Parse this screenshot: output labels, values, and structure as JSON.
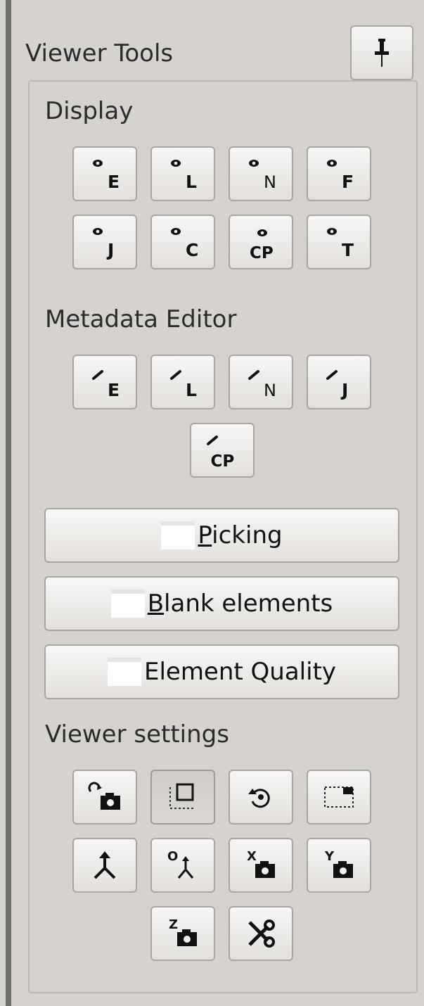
{
  "panel": {
    "title": "Viewer Tools",
    "pin_icon": "pin-icon"
  },
  "display": {
    "label": "Display",
    "buttons": [
      {
        "letter": "E",
        "icon": "eye-icon"
      },
      {
        "letter": "L",
        "icon": "eye-icon"
      },
      {
        "letter": "N",
        "icon": "eye-icon"
      },
      {
        "letter": "F",
        "icon": "eye-icon"
      },
      {
        "letter": "J",
        "icon": "eye-icon"
      },
      {
        "letter": "C",
        "icon": "eye-icon"
      },
      {
        "letter": "CP",
        "icon": "eye-icon"
      },
      {
        "letter": "T",
        "icon": "eye-icon"
      }
    ]
  },
  "metadata": {
    "label": "Metadata Editor",
    "buttons": [
      {
        "letter": "E",
        "icon": "pencil-icon"
      },
      {
        "letter": "L",
        "icon": "pencil-icon"
      },
      {
        "letter": "N",
        "icon": "pencil-icon"
      },
      {
        "letter": "J",
        "icon": "pencil-icon"
      },
      {
        "letter": "CP",
        "icon": "pencil-icon"
      }
    ]
  },
  "toggles": {
    "picking": {
      "mnemonic": "P",
      "rest": "icking"
    },
    "blank": {
      "mnemonic": "B",
      "rest": "lank elements"
    },
    "quality": {
      "label": "Element Quality"
    }
  },
  "viewer_settings": {
    "label": "Viewer settings",
    "buttons": [
      {
        "name": "rotate-camera-button",
        "icon": "rotate-camera-icon",
        "letter": ""
      },
      {
        "name": "fit-selection-button",
        "icon": "fit-selection-icon",
        "letter": "",
        "pressed": true
      },
      {
        "name": "reset-view-button",
        "icon": "reset-view-icon",
        "letter": ""
      },
      {
        "name": "zoom-window-button",
        "icon": "zoom-window-icon",
        "letter": ""
      },
      {
        "name": "isometric-view-button",
        "icon": "axes-icon",
        "letter": ""
      },
      {
        "name": "origin-axes-button",
        "icon": "origin-axes-icon",
        "letter": "O"
      },
      {
        "name": "view-x-button",
        "icon": "camera-icon",
        "letter": "X"
      },
      {
        "name": "view-y-button",
        "icon": "camera-icon",
        "letter": "Y"
      },
      {
        "name": "view-z-button",
        "icon": "camera-icon",
        "letter": "Z"
      },
      {
        "name": "clip-button",
        "icon": "scissors-icon",
        "letter": ""
      }
    ]
  },
  "colors": {
    "panel_bg": "#d6d3cf",
    "button_bg": "#f8f7f6",
    "border": "#a9a5a0"
  }
}
